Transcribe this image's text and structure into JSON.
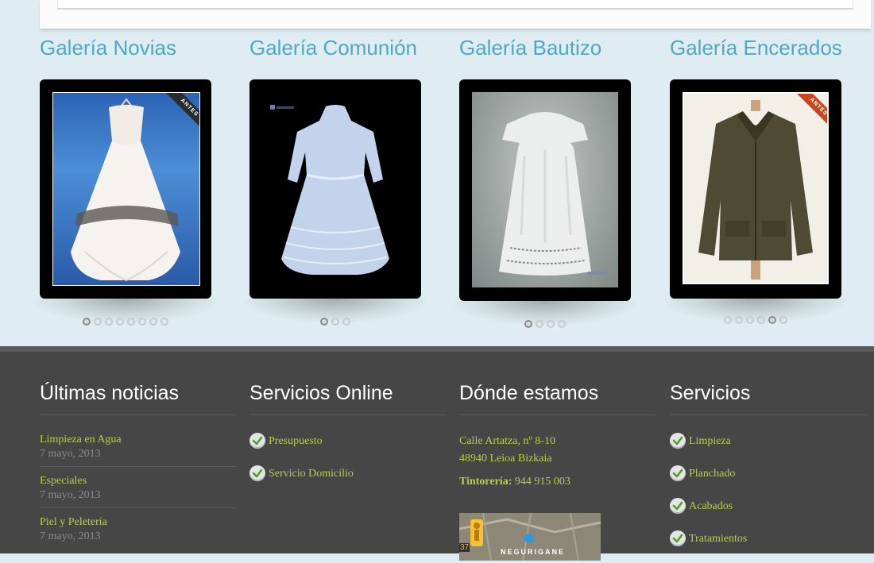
{
  "galleries": [
    {
      "title": "Galería Novias",
      "badge": "ANTES",
      "dots": 8,
      "active": 0
    },
    {
      "title": "Galería Comunión",
      "dots": 3,
      "active": 0
    },
    {
      "title": "Galería Bautizo",
      "dots": 4,
      "active": 0
    },
    {
      "title": "Galería Encerados",
      "badge": "ANTES",
      "dots": 6,
      "active": 4
    }
  ],
  "footer": {
    "news": {
      "heading": "Últimas noticias",
      "items": [
        {
          "title": "Limpieza en Agua",
          "date": "7 mayo, 2013"
        },
        {
          "title": "Especiales",
          "date": "7 mayo, 2013"
        },
        {
          "title": "Piel y Peletería",
          "date": "7 mayo, 2013"
        }
      ]
    },
    "online": {
      "heading": "Servicios Online",
      "links": [
        "Presupuesto",
        "Servicio Domicilio"
      ]
    },
    "location": {
      "heading": "Dónde estamos",
      "address_line1": "Calle Artatza, nº 8-10",
      "address_line2": "48940 Leioa Bizkaia",
      "phone_label": "Tintorería:",
      "phone": "944 915 003",
      "map_text": "NEGURIGANE",
      "map_number": "37"
    },
    "services": {
      "heading": "Servicios",
      "links": [
        "Limpieza",
        "Planchado",
        "Acabados",
        "Tratamientos"
      ]
    }
  },
  "colors": {
    "accent_link": "#b6cf45",
    "gallery_title": "#4fa8c6",
    "footer_bg": "#464646",
    "page_bg": "#dfedf2"
  }
}
